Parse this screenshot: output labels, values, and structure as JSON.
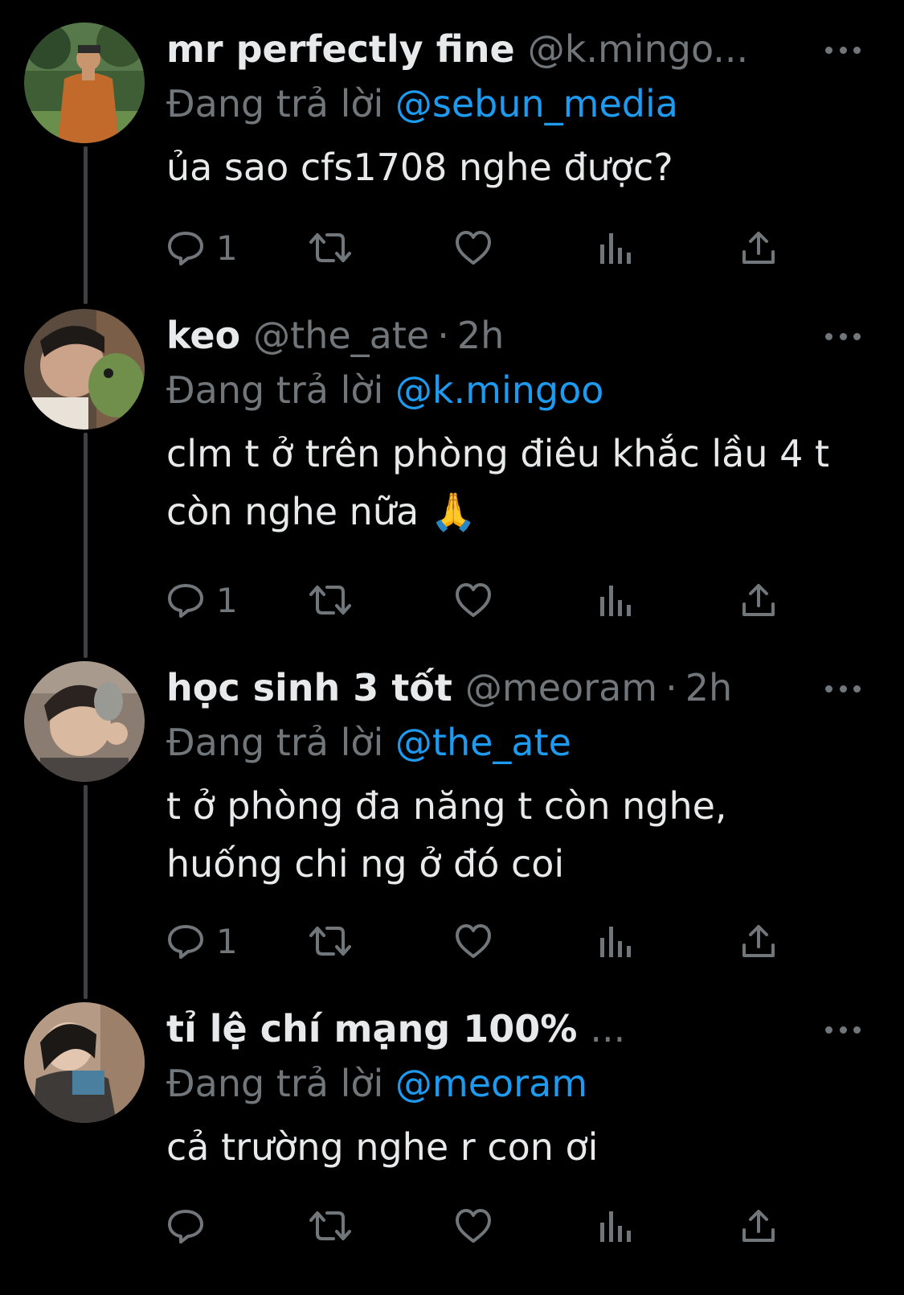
{
  "tweets": [
    {
      "display_name": "mr perfectly fine",
      "handle": "@k.mingo...",
      "time_sep": "",
      "time": "",
      "reply_prefix": "Đang trả lời",
      "reply_to": "@sebun_media",
      "text": "ủa sao cfs1708 nghe được?",
      "reply_count": "1"
    },
    {
      "display_name": "keo",
      "handle": "@the_ate",
      "time_sep": "·",
      "time": "2h",
      "reply_prefix": "Đang trả lời",
      "reply_to": "@k.mingoo",
      "text": "clm t ở trên phòng điêu khắc lầu 4 t còn nghe nữa 🙏",
      "reply_count": "1"
    },
    {
      "display_name": "học sinh 3 tốt",
      "handle": "@meoram",
      "time_sep": "·",
      "time": "2h",
      "reply_prefix": "Đang trả lời",
      "reply_to": "@the_ate",
      "text": "t ở phòng đa năng t còn nghe,\nhuống chi ng ở đó coi",
      "reply_count": "1"
    },
    {
      "display_name": "tỉ lệ chí mạng 100%",
      "handle": "...",
      "time_sep": "",
      "time": "",
      "reply_prefix": "Đang trả lời",
      "reply_to": "@meoram",
      "text": "cả trường nghe r con ơi",
      "reply_count": ""
    }
  ],
  "colors": {
    "background": "#000000",
    "primary_text": "#e7e9ea",
    "secondary_text": "#71767b",
    "link": "#1d9bf0",
    "thread_line": "#3e4144"
  },
  "icons": {
    "reply": "speech-bubble-icon",
    "retweet": "retweet-arrows-icon",
    "like": "heart-icon",
    "views": "bar-chart-icon",
    "share": "share-upload-icon",
    "more": "ellipsis-icon"
  }
}
